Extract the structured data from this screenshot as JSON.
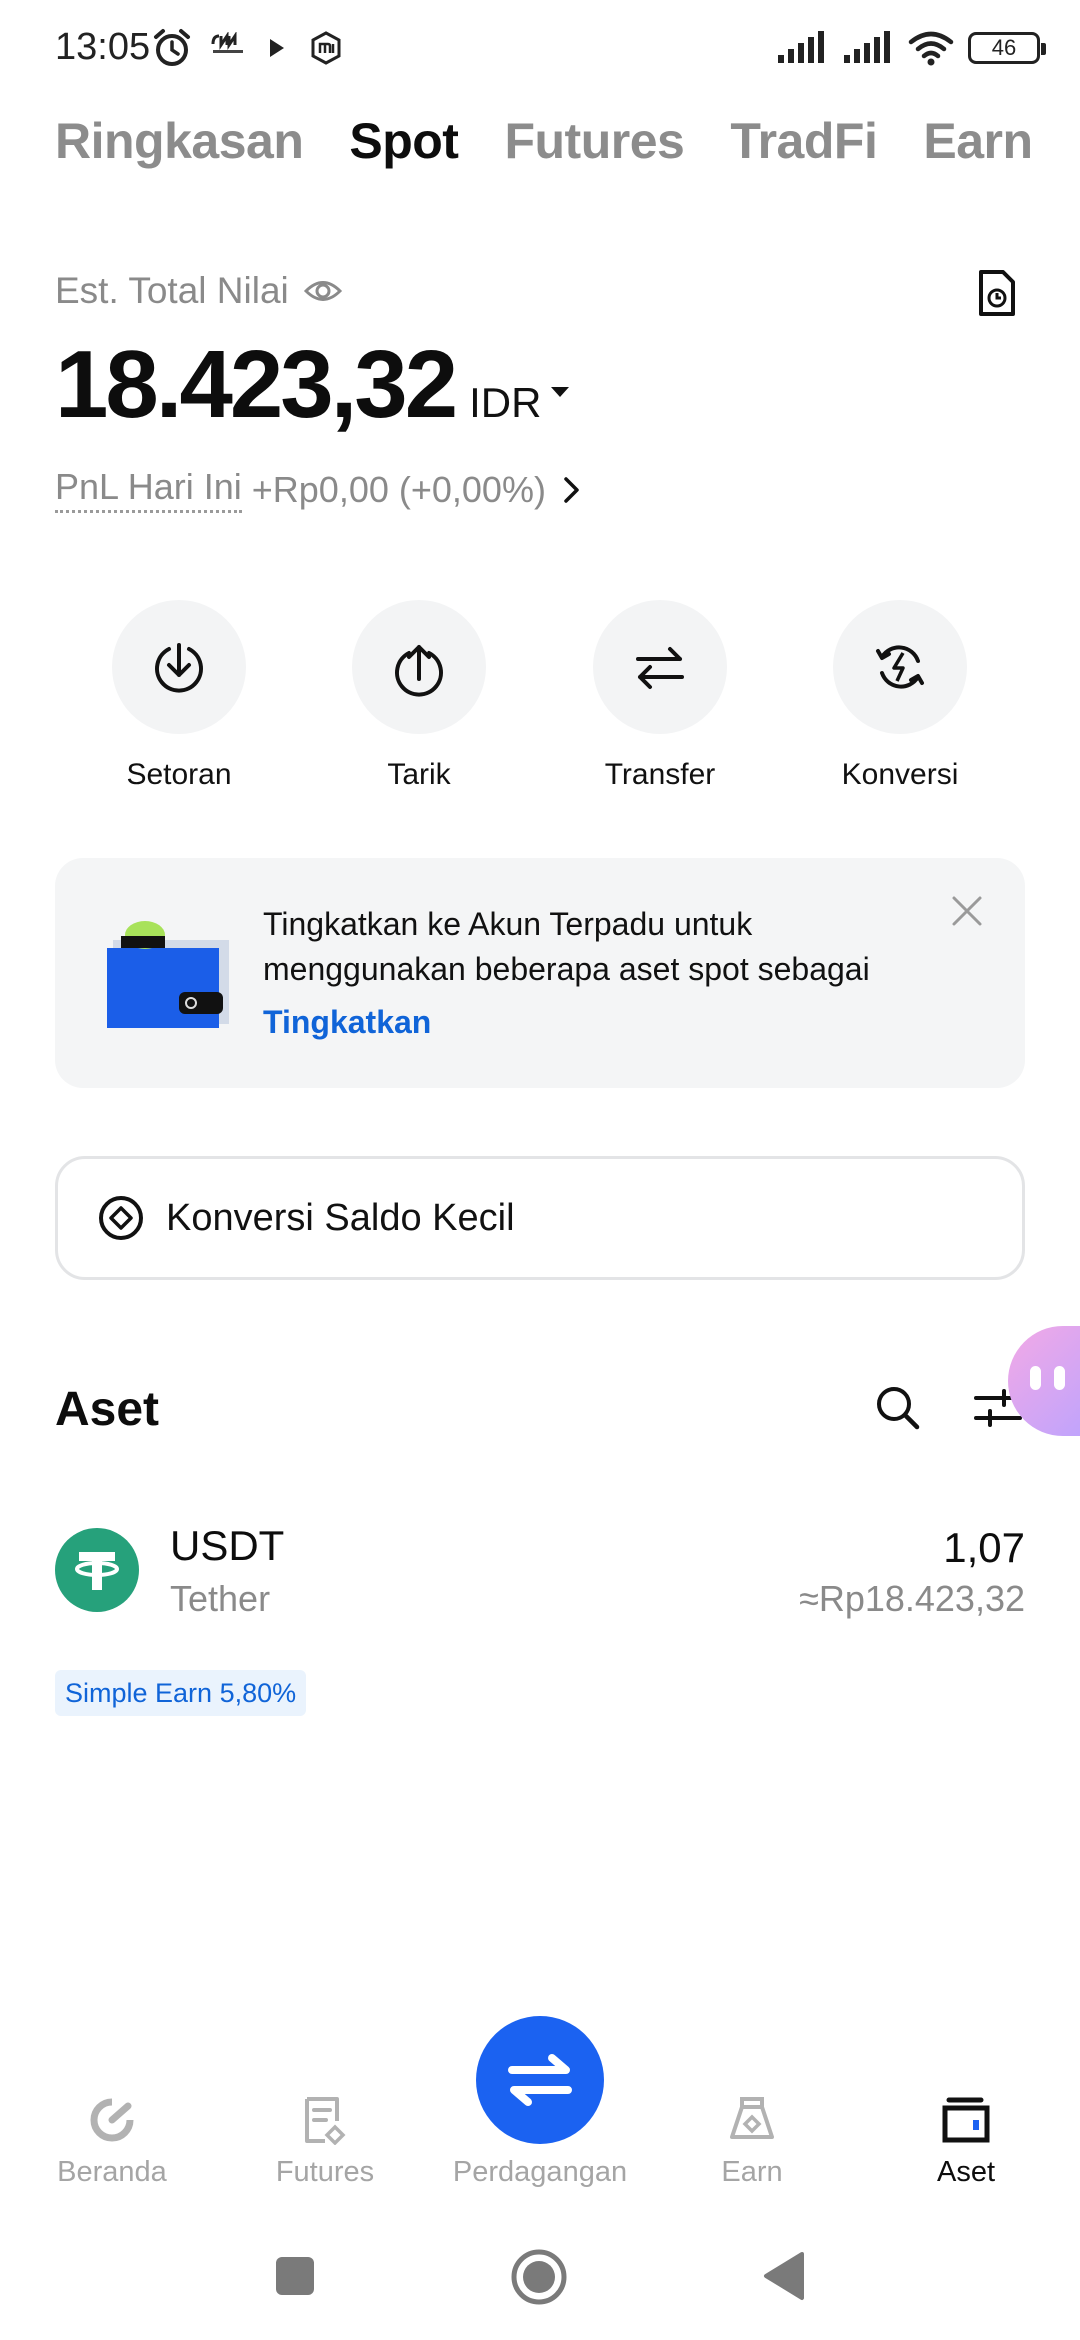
{
  "status_bar": {
    "time": "13:05",
    "battery": "46",
    "icons": [
      "alarm-icon",
      "cnn-indonesia-icon",
      "play-icon",
      "mi-icon",
      "signal-icon",
      "signal-icon",
      "wifi-icon",
      "battery-icon"
    ]
  },
  "tabs": [
    {
      "label": "Ringkasan",
      "active": false
    },
    {
      "label": "Spot",
      "active": true
    },
    {
      "label": "Futures",
      "active": false
    },
    {
      "label": "TradFi",
      "active": false
    },
    {
      "label": "Earn",
      "active": false
    }
  ],
  "balance": {
    "label": "Est. Total Nilai",
    "value": "18.423,32",
    "currency": "IDR",
    "pnl_label": "PnL Hari Ini",
    "pnl_value": "+Rp0,00 (+0,00%)"
  },
  "actions": [
    {
      "label": "Setoran",
      "icon": "deposit-icon"
    },
    {
      "label": "Tarik",
      "icon": "withdraw-icon"
    },
    {
      "label": "Transfer",
      "icon": "transfer-icon"
    },
    {
      "label": "Konversi",
      "icon": "convert-icon"
    }
  ],
  "upgrade_card": {
    "line1": "Tingkatkan ke Akun Terpadu untuk",
    "line2": "menggunakan beberapa aset spot sebagai",
    "link": "Tingkatkan"
  },
  "small_balance": {
    "label": "Konversi Saldo Kecil"
  },
  "assets": {
    "title": "Aset",
    "items": [
      {
        "symbol": "USDT",
        "name": "Tether",
        "amount": "1,07",
        "fiat_value": "≈Rp18.423,32",
        "badge": "Simple Earn 5,80%",
        "logo_color": "#26a17b"
      }
    ]
  },
  "bottom_nav": [
    {
      "label": "Beranda",
      "icon": "home-icon",
      "active": false
    },
    {
      "label": "Futures",
      "icon": "futures-icon",
      "active": false
    },
    {
      "label": "Perdagangan",
      "icon": "trade-icon",
      "active": false
    },
    {
      "label": "Earn",
      "icon": "earn-icon",
      "active": false
    },
    {
      "label": "Aset",
      "icon": "assets-icon",
      "active": true
    }
  ],
  "colors": {
    "accent_blue": "#1b62f1",
    "link_blue": "#1064d8",
    "tether_green": "#26a17b",
    "muted_text": "#8a8a8a"
  }
}
